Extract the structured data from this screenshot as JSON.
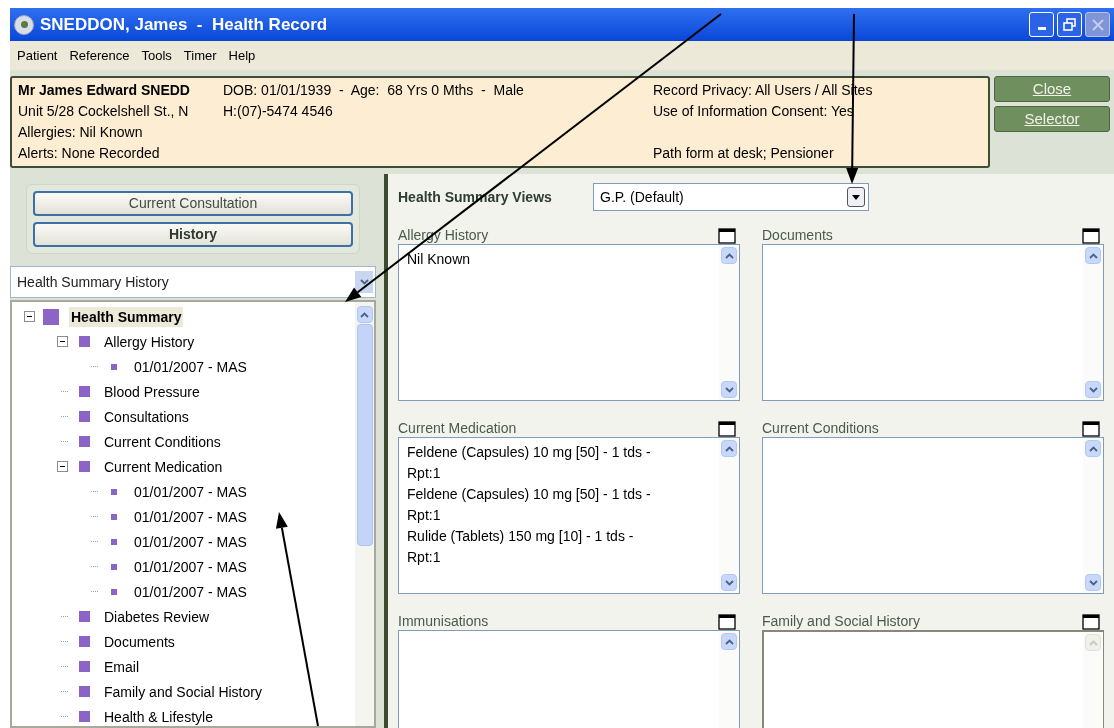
{
  "window": {
    "title": "SNEDDON, James  -  Health Record"
  },
  "menu": [
    "Patient",
    "Reference",
    "Tools",
    "Timer",
    "Help"
  ],
  "banner": {
    "name": "Mr James Edward SNEDD",
    "address": "Unit 5/28 Cockelshell St., N",
    "dob": "DOB: 01/01/1939  -  Age:  68 Yrs 0 Mths  -  Male",
    "phone": "H:(07)-5474 4546",
    "allergies": "Allergies: Nil Known",
    "alerts": "Alerts: None Recorded",
    "right_lines": [
      "Record Privacy: All Users / All Sites",
      "Use of Information Consent: Yes",
      "Path form at desk; Pensioner"
    ]
  },
  "side_buttons": [
    "Close",
    "Selector"
  ],
  "mode_buttons": [
    {
      "label": "Current Consultation",
      "selected": false
    },
    {
      "label": "History",
      "selected": true
    }
  ],
  "history_select": {
    "value": "Health Summary History"
  },
  "tree": [
    {
      "label": "Health Summary",
      "selected": true,
      "expanded": true,
      "children": [
        {
          "label": "Allergy History",
          "selected": false,
          "expanded": true,
          "children": [
            {
              "label": "01/01/2007 - MAS",
              "selected": false
            }
          ]
        },
        {
          "label": "Blood Pressure",
          "selected": false
        },
        {
          "label": "Consultations",
          "selected": false
        },
        {
          "label": "Current Conditions",
          "selected": false
        },
        {
          "label": "Current Medication",
          "selected": false,
          "expanded": true,
          "children": [
            {
              "label": "01/01/2007 - MAS",
              "selected": false
            },
            {
              "label": "01/01/2007 - MAS",
              "selected": false
            },
            {
              "label": "01/01/2007 - MAS",
              "selected": false
            },
            {
              "label": "01/01/2007 - MAS",
              "selected": false
            },
            {
              "label": "01/01/2007 - MAS",
              "selected": false
            }
          ]
        },
        {
          "label": "Diabetes Review",
          "selected": false
        },
        {
          "label": "Documents",
          "selected": false
        },
        {
          "label": "Email",
          "selected": false
        },
        {
          "label": "Family and Social History",
          "selected": false
        },
        {
          "label": "Health & Lifestyle",
          "selected": false
        }
      ]
    }
  ],
  "views": {
    "label": "Health Summary Views",
    "value": "G.P. (Default)"
  },
  "panels": [
    {
      "title": "Allergy History",
      "lines": [
        "Nil Known"
      ],
      "disabled": false
    },
    {
      "title": "Documents",
      "disabled": false
    },
    {
      "title": "Current Medication",
      "lines": [
        "Feldene (Capsules) 10 mg [50] - 1 tds -",
        "Rpt:1",
        "Feldene (Capsules) 10 mg [50] - 1 tds -",
        "Rpt:1",
        "Rulide (Tablets) 150 mg [10] - 1 tds -",
        "Rpt:1"
      ],
      "disabled": false
    },
    {
      "title": "Current Conditions",
      "disabled": false
    },
    {
      "title": "Immunisations",
      "disabled": false
    },
    {
      "title": "Family and Social History",
      "disabled": true
    }
  ]
}
